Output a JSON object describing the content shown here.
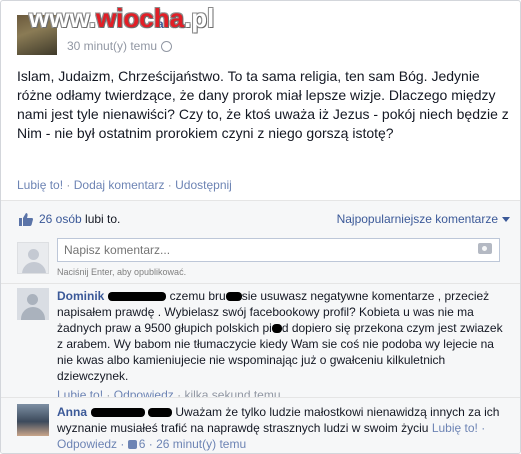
{
  "post": {
    "watermark": {
      "prefix": "www.",
      "brand": "wiocha",
      "suffix": ".pl"
    },
    "author_tail": "a",
    "time": "30 minut(y) temu",
    "text": "Islam, Judaizm, Chrześcijaństwo. To ta sama religia, ten sam Bóg. Jedynie różne odłamy twierdzące, że dany prorok miał lepsze wizje. Dlaczego między nami jest tyle nienawiści? Czy to, że ktoś uważa iż Jezus - pokój niech będzie z Nim - nie był ostatnim prorokiem czyni z niego gorszą istotę?",
    "actions": {
      "like": "Lubię to!",
      "comment": "Dodaj komentarz",
      "share": "Udostępnij",
      "sep": "·"
    }
  },
  "likes": {
    "count": "26 osób",
    "suffix": " lubi to.",
    "sort_label": "Najpopularniejsze komentarze"
  },
  "composer": {
    "placeholder": "Napisz komentarz...",
    "hint": "Naciśnij Enter, aby opublikować."
  },
  "comments": [
    {
      "name": "Dominik",
      "text_a": " czemu bru",
      "text_b": "sie usuwasz negatywne komentarze , przecież napisałem prawdę . Wybielasz swój facebookowy profil? Kobieta u was nie ma żadnych praw a 9500 głupich polskich pi",
      "text_c": "d dopiero się przekona czym jest zwiazek z arabem. Wy babom nie tłumaczycie kiedy Wam sie coś nie podoba wy lejecie na nie kwas albo kamieniujecie nie wspominając już o gwałceniu kilkuletnich dziewczynek.",
      "like": "Lubię to!",
      "reply": "Odpowiedz",
      "time": "kilka sekund temu"
    },
    {
      "name": "Anna",
      "text": "Uważam że tylko ludzie małostkowi nienawidzą innych za ich wyznanie musiałeś trafić na naprawdę strasznych ludzi w swoim życiu",
      "like": "Lubię to!",
      "reply": "Odpowiedz",
      "likes": "6",
      "time": "26 minut(y) temu"
    }
  ],
  "colors": {
    "link": "#3b5998",
    "muted": "#9197a3",
    "bg": "#f6f7f8"
  },
  "icons": [
    "globe-icon",
    "thumbs-up-icon",
    "camera-icon",
    "dropdown-caret-icon"
  ]
}
